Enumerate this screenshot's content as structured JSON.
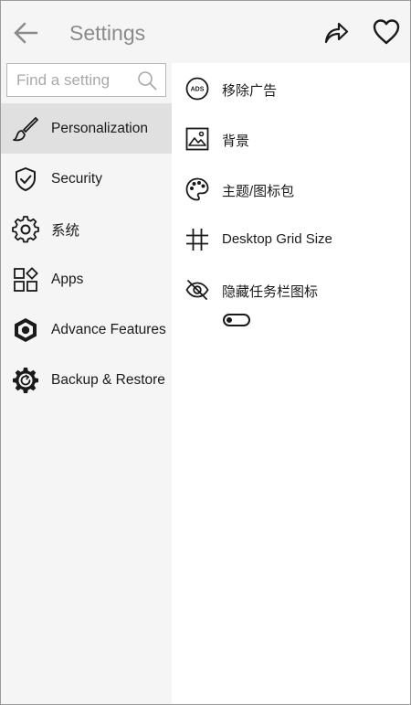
{
  "header": {
    "title": "Settings"
  },
  "search": {
    "placeholder": "Find a setting"
  },
  "sidebar": {
    "items": [
      {
        "label": "Personalization",
        "icon": "brush-icon",
        "active": true
      },
      {
        "label": "Security",
        "icon": "shield-check-icon",
        "active": false
      },
      {
        "label": "系统",
        "icon": "gear-icon",
        "active": false
      },
      {
        "label": "Apps",
        "icon": "apps-grid-icon",
        "active": false
      },
      {
        "label": "Advance Features",
        "icon": "hexagon-dot-icon",
        "active": false
      },
      {
        "label": "Backup & Restore",
        "icon": "gear-refresh-icon",
        "active": false
      }
    ]
  },
  "main": {
    "options": [
      {
        "label": "移除广告",
        "icon": "ads-circle-icon"
      },
      {
        "label": "背景",
        "icon": "image-icon"
      },
      {
        "label": "主题/图标包",
        "icon": "palette-icon"
      },
      {
        "label": "Desktop Grid Size",
        "icon": "grid-icon"
      },
      {
        "label": "隐藏任务栏图标",
        "icon": "eye-off-icon"
      }
    ],
    "hide_taskbar_toggle": {
      "state": "off"
    }
  },
  "colors": {
    "background": "#f5f5f5",
    "panel": "#ffffff",
    "active_item": "#e0e0e0",
    "title_text": "#8a8a8a",
    "text": "#1a1a1a"
  }
}
